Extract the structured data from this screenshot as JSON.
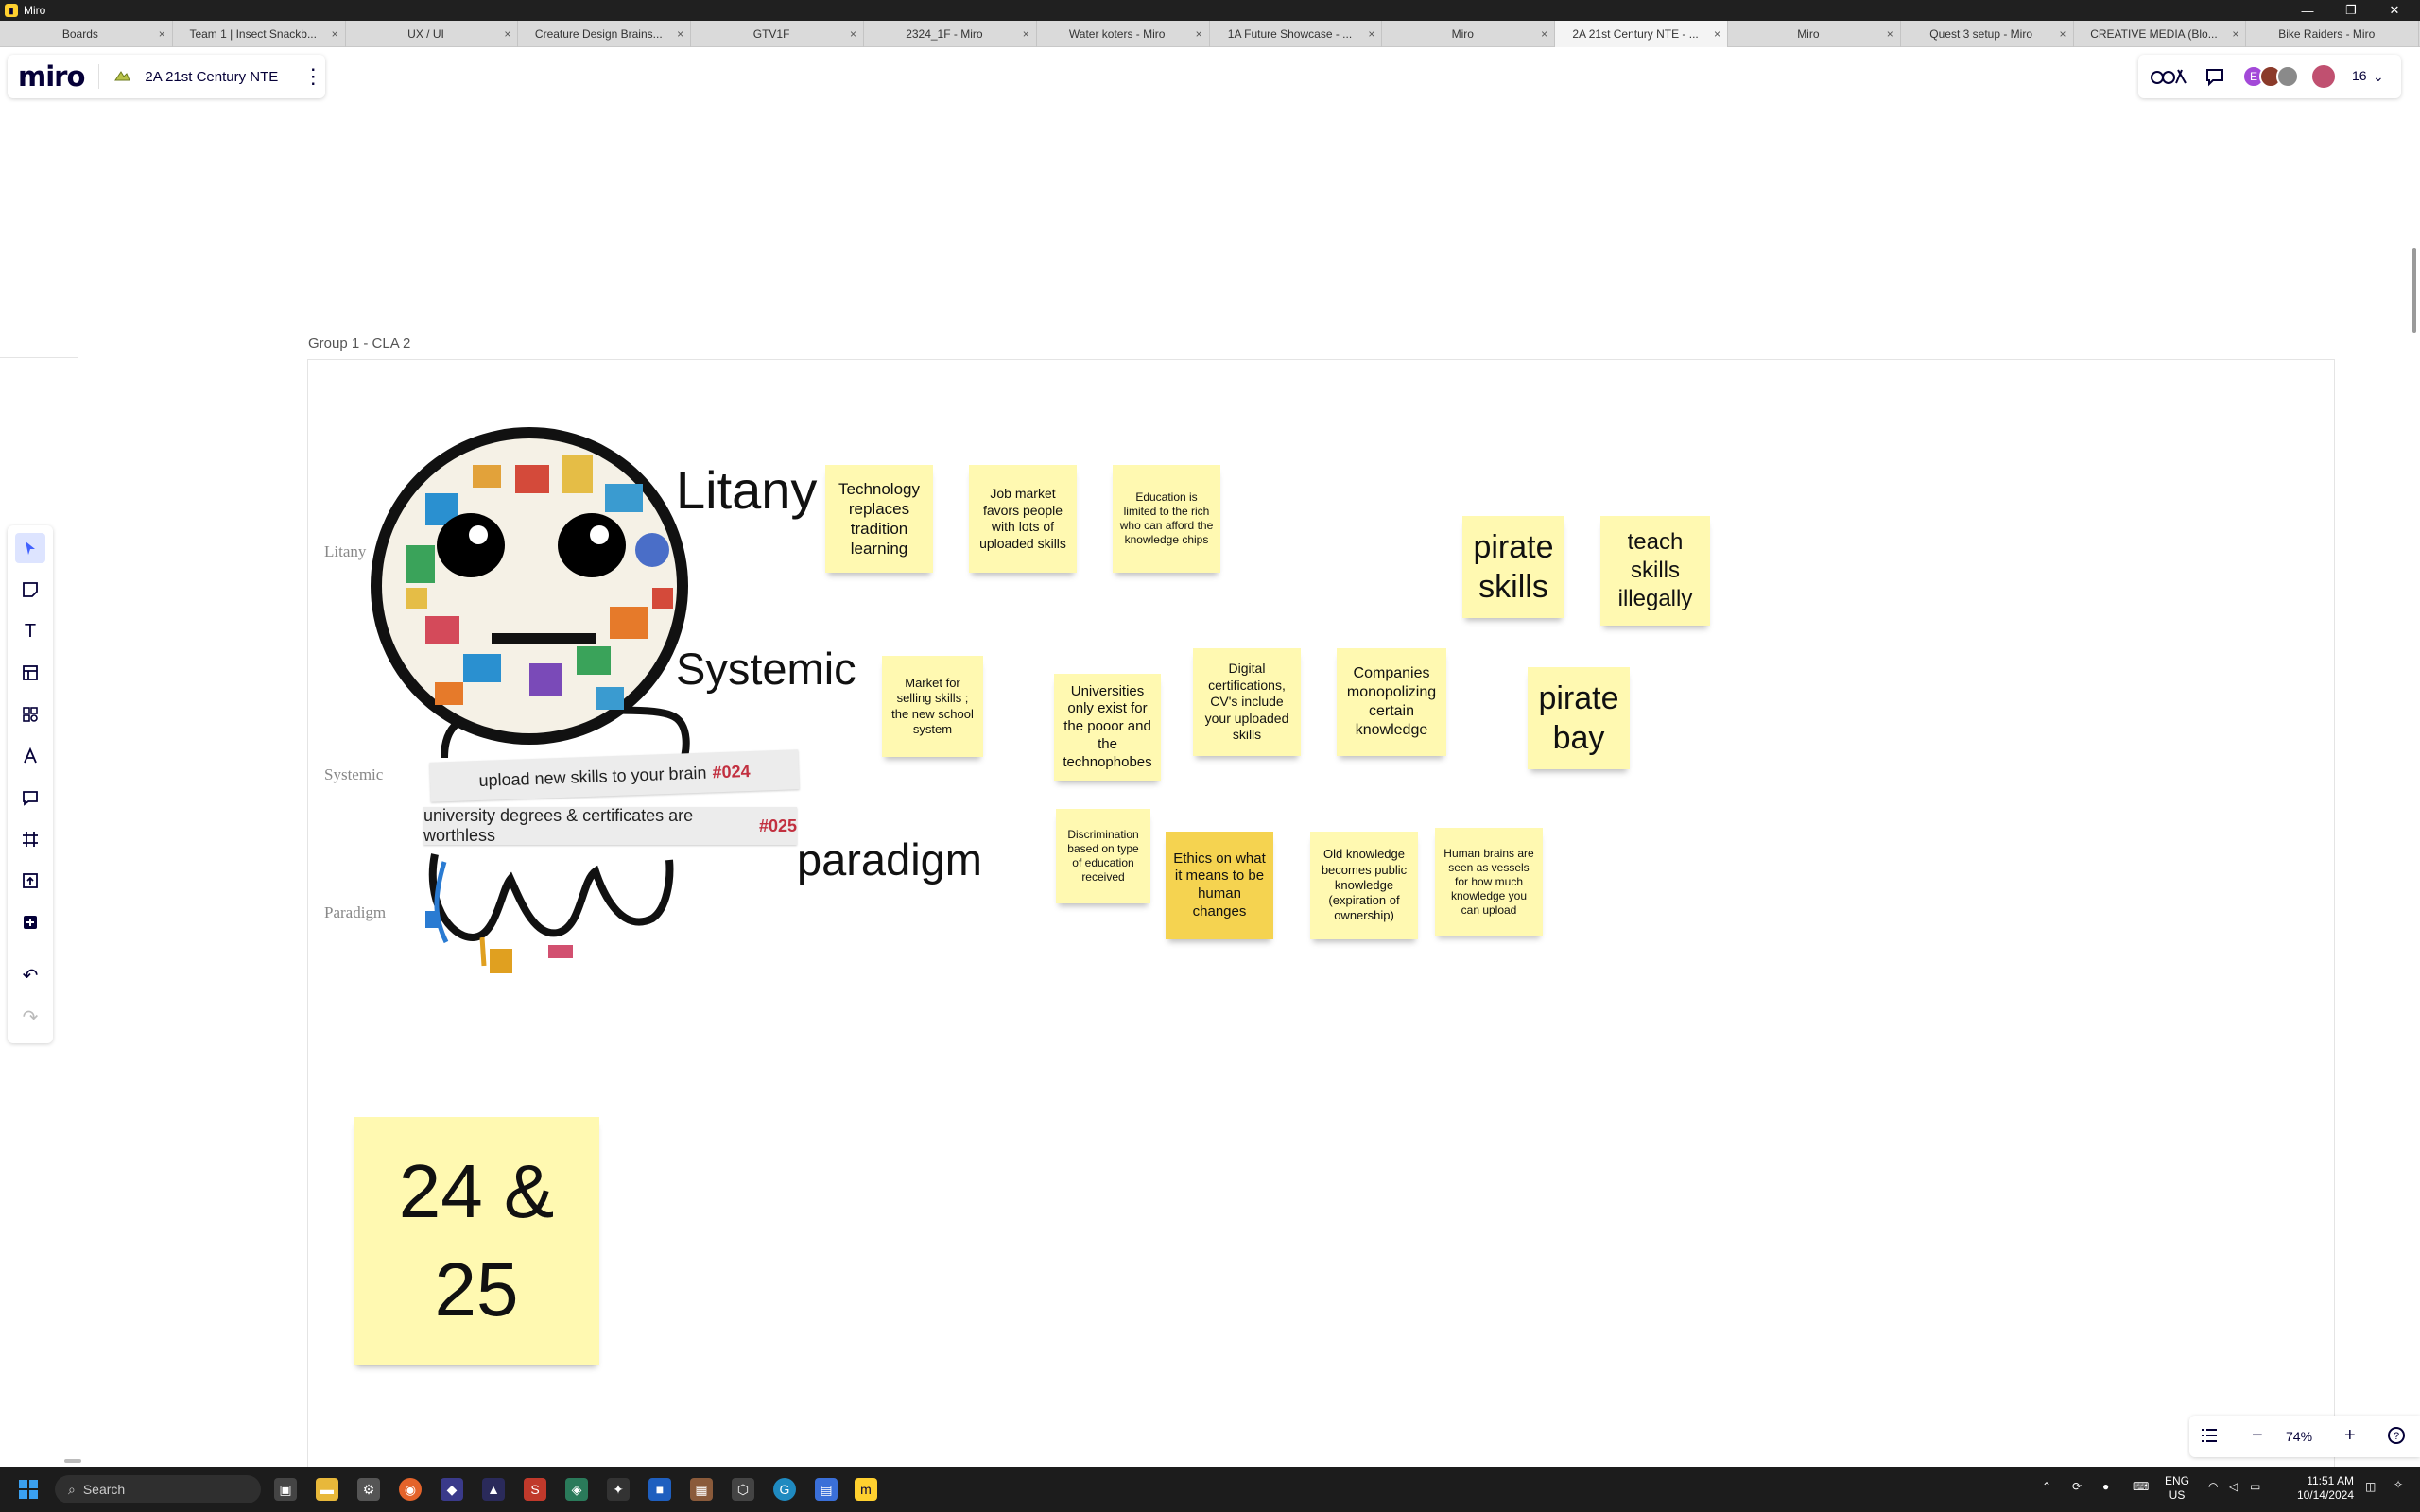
{
  "window": {
    "app_title": "Miro",
    "minimize": "—",
    "maximize": "❐",
    "close": "✕"
  },
  "tabs": [
    {
      "label": "Boards"
    },
    {
      "label": "Team 1 | Insect Snackb..."
    },
    {
      "label": "UX / UI"
    },
    {
      "label": "Creature Design Brains..."
    },
    {
      "label": "GTV1F"
    },
    {
      "label": "2324_1F - Miro"
    },
    {
      "label": "Water koters - Miro"
    },
    {
      "label": "1A Future Showcase - ..."
    },
    {
      "label": "Miro"
    },
    {
      "label": "2A 21st Century NTE - ...",
      "active": true
    },
    {
      "label": "Miro"
    },
    {
      "label": "Quest 3 setup - Miro"
    },
    {
      "label": "CREATIVE MEDIA (Blo..."
    },
    {
      "label": "Bike Raiders - Miro"
    }
  ],
  "board": {
    "logo": "miro",
    "name": "2A 21st Century NTE",
    "icon": "board-thumbnail-icon"
  },
  "collab": {
    "user_count": "16",
    "avatar_letter": "E"
  },
  "canvas": {
    "frame_title": "Group 1 - CLA 2",
    "row_labels": {
      "litany": "Litany",
      "systemic": "Systemic",
      "paradigm": "Paradigm"
    },
    "big_labels": {
      "litany": "Litany",
      "systemic": "Systemic",
      "paradigm": "paradigm"
    },
    "banners": [
      {
        "text": "upload new skills to your brain",
        "tag": "#024"
      },
      {
        "text": "university degrees & certificates are worthless",
        "tag": "#025"
      }
    ],
    "stickies": {
      "s1": "Technology replaces tradition learning",
      "s2": "Job market favors people with lots of uploaded skills",
      "s3": "Education is limited to the rich who can afford the knowledge chips",
      "s4": "pirate skills",
      "s5": "teach skills illegally",
      "s6": "Market for selling skills ; the new school system",
      "s7": "Universities only exist for the pooor and the technophobes",
      "s8": "Digital certifications, CV's include your uploaded skills",
      "s9": "Companies monopolizing certain knowledge",
      "s10": "pirate bay",
      "s11": "Discrimination based on type of education received",
      "s12": "Ethics on what it means to be human changes",
      "s13": "Old knowledge becomes public knowledge (expiration of ownership)",
      "s14": "Human brains are seen as vessels for how much knowledge you can upload",
      "s15": "24 & 25"
    }
  },
  "zoom": {
    "level": "74%"
  },
  "taskbar": {
    "search_placeholder": "Search",
    "lang": "ENG",
    "region": "US",
    "time": "11:51 AM",
    "date": "10/14/2024"
  },
  "colors": {
    "sticky_yellow": "#fff9b1",
    "sticky_orange": "#f5d350",
    "accent": "#4262ff"
  }
}
